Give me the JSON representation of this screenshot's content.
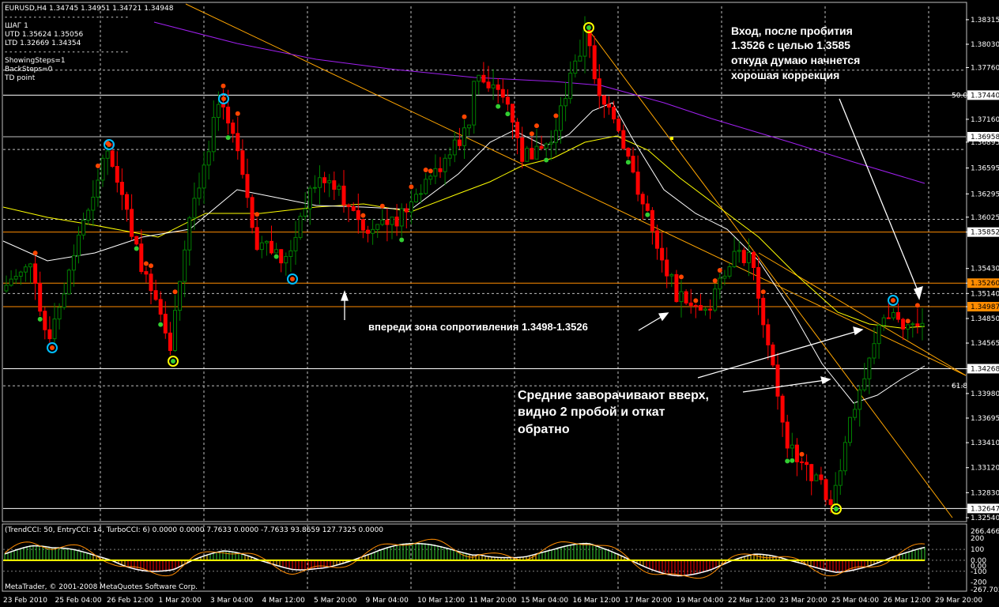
{
  "chart_data": {
    "type": "candlestick",
    "symbol_line": "EURUSD,H4  1.34745 1.34951 1.34721 1.34948",
    "info_lines": [
      "- - - - - - - - - - - - - - - - - - - - - - - - - -",
      "           ШАГ 1",
      "UTD  1.35624  1.35056",
      "LTD  1.32669  1.34354",
      "- - - - - - - - - - - - - - - - - - - - - - - - - -",
      "ShowingSteps=1",
      "BackSteps=0",
      "TD point"
    ],
    "y_axis": {
      "range": [
        1.3254,
        1.3847
      ],
      "ticks": [
        "1.38315",
        "1.38030",
        "1.37760",
        "1.37440",
        "1.37160",
        "1.36895",
        "1.36595",
        "1.36295",
        "1.36025",
        "1.35852",
        "1.35430",
        "1.35260",
        "1.35140",
        "1.34987",
        "1.34850",
        "1.34565",
        "1.34268",
        "1.33980",
        "1.33695",
        "1.33410",
        "1.33120",
        "1.32830",
        "1.32647",
        "1.32540"
      ]
    },
    "x_axis": {
      "ticks": [
        "23 Feb 2010",
        "25 Feb 04:00",
        "26 Feb 12:00",
        "1 Mar 20:00",
        "3 Mar 04:00",
        "4 Mar 12:00",
        "5 Mar 20:00",
        "9 Mar 04:00",
        "10 Mar 12:00",
        "11 Mar 20:00",
        "15 Mar 04:00",
        "16 Mar 12:00",
        "17 Mar 20:00",
        "19 Mar 04:00",
        "22 Mar 12:00",
        "23 Mar 20:00",
        "25 Mar 04:00",
        "26 Mar 12:00",
        "29 Mar 20:00"
      ]
    },
    "levels": [
      {
        "value": 1.3744,
        "label": "1.37440",
        "color": "#ffffff",
        "tag_bg": "#ffffff",
        "tag_fg": "#000000"
      },
      {
        "value": 1.36958,
        "label": "1.36958",
        "color": "#c0c0c0",
        "tag_bg": "#ffffff",
        "tag_fg": "#000000"
      },
      {
        "value": 1.35852,
        "label": "1.35852",
        "color": "#ff8c00",
        "tag_bg": "#ffffff",
        "tag_fg": "#000000"
      },
      {
        "value": 1.3526,
        "label": "1.35260",
        "color": "#ff8c00",
        "tag_bg": "#ff8c00",
        "tag_fg": "#000000"
      },
      {
        "value": 1.34987,
        "label": "1.34987",
        "color": "#ff8c00",
        "tag_bg": "#ff8c00",
        "tag_fg": "#000000"
      },
      {
        "value": 1.34268,
        "label": "1.34268",
        "color": "#ffffff",
        "tag_bg": "#ffffff",
        "tag_fg": "#000000"
      },
      {
        "value": 1.32647,
        "label": "1.32647",
        "color": "#ffffff",
        "tag_bg": "#ffffff",
        "tag_fg": "#000000"
      }
    ],
    "fib_labels": [
      {
        "text": "50.0",
        "value": 1.3744
      },
      {
        "text": "61.8",
        "value": 1.3407
      }
    ],
    "annotations": {
      "top_right": [
        "Вход, после пробития",
        "1.3526 с целью 1.3585",
        "откуда думаю начнется",
        "хорошая коррекция"
      ],
      "resistance": "впереди зона сопротивления 1.3498-1.3526",
      "bottom": [
        "Средние заворачивают вверх,",
        "видно 2 пробой и откат",
        "обратно"
      ]
    },
    "indicator": {
      "header": "(TrendCCI: 50, EntryCCI: 14, TurboCCI: 6)  0.0000 0.0000 7.7633 0.0000 -7.7633 93.8659 127.7325 0.0000",
      "ticks": [
        "266.4666",
        "200",
        "100",
        "0.00",
        "0.00",
        "-100",
        "-200",
        "-267.703"
      ]
    },
    "copyright": "MetaTrader, © 2001-2008 MetaQuotes Software Corp.",
    "colors": {
      "bull": "#008000",
      "bear": "#ff0000",
      "ma_white": "#ffffff",
      "ma_yellow": "#ffff00",
      "ma_purple": "#a020f0",
      "trend_orange": "#ffa500",
      "grid": "#c0c0c0"
    }
  }
}
